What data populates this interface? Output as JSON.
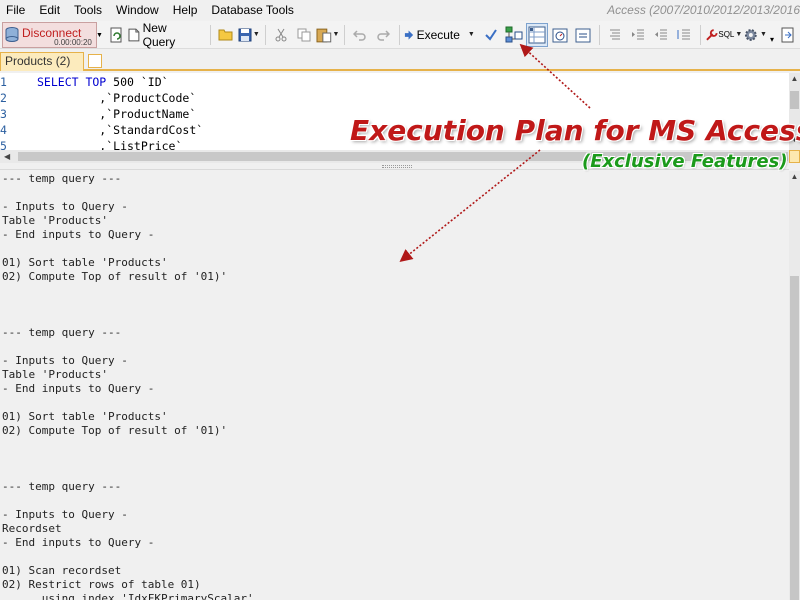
{
  "menu": {
    "items": [
      "File",
      "Edit",
      "Tools",
      "Window",
      "Help",
      "Database Tools"
    ],
    "app_caption": "Access (2007/2010/2012/2013/2016"
  },
  "toolbar": {
    "disconnect_label": "Disconnect",
    "timer": "0.00:00:20",
    "new_query_label": "New Query",
    "execute_label": "Execute",
    "sql_label": "SQL"
  },
  "tabs": {
    "active_label": "Products (2)"
  },
  "editor": {
    "lines": [
      {
        "n": "1",
        "kw": "SELECT TOP",
        "rest": " 500 `ID`"
      },
      {
        "n": "2",
        "kw": "",
        "rest": "         ,`ProductCode`"
      },
      {
        "n": "3",
        "kw": "",
        "rest": "         ,`ProductName`"
      },
      {
        "n": "4",
        "kw": "",
        "rest": "         ,`StandardCost`"
      },
      {
        "n": "5",
        "kw": "",
        "rest": "         ,`ListPrice`"
      }
    ]
  },
  "output": {
    "lines": [
      "--- temp query ---",
      "",
      "- Inputs to Query -",
      "Table 'Products'",
      "- End inputs to Query -",
      "",
      "01) Sort table 'Products'",
      "02) Compute Top of result of '01)'",
      "",
      "",
      "",
      "--- temp query ---",
      "",
      "- Inputs to Query -",
      "Table 'Products'",
      "- End inputs to Query -",
      "",
      "01) Sort table 'Products'",
      "02) Compute Top of result of '01)'",
      "",
      "",
      "",
      "--- temp query ---",
      "",
      "- Inputs to Query -",
      "Recordset",
      "- End inputs to Query -",
      "",
      "01) Scan recordset",
      "02) Restrict rows of table 01)",
      "      using index 'IdxFKPrimaryScalar'"
    ]
  },
  "annotation": {
    "title": "Execution Plan for MS Access",
    "subtitle": "(Exclusive Features)",
    "title_color": "#c01818",
    "subtitle_color": "#1b9a1b"
  }
}
